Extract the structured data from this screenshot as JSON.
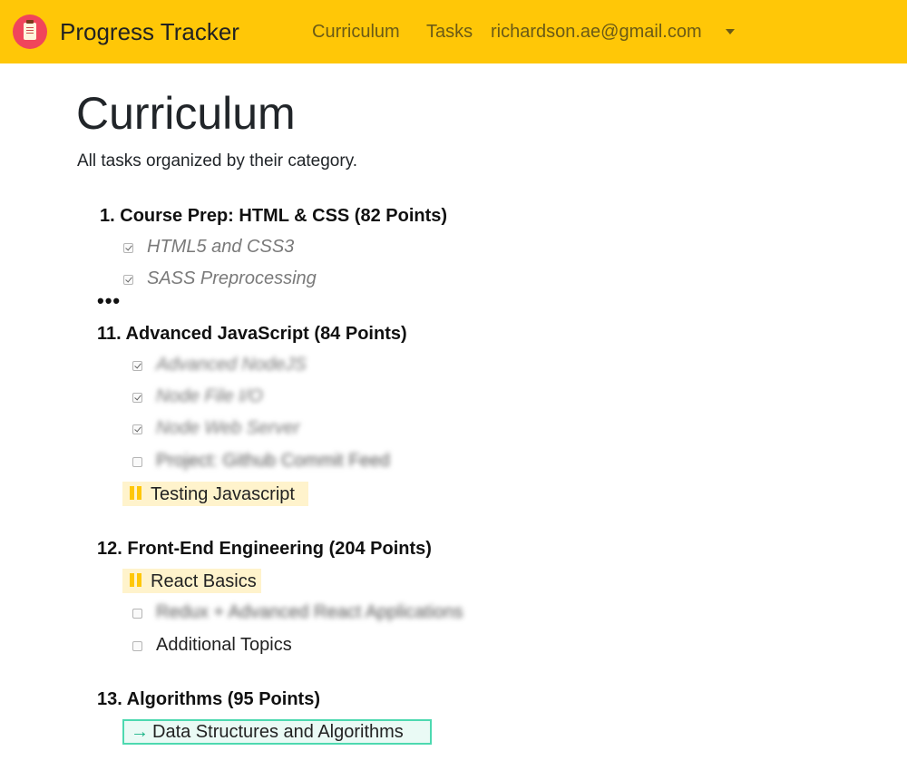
{
  "navbar": {
    "brand": "Progress Tracker",
    "links": [
      "Curriculum",
      "Tasks"
    ],
    "user_email": "richardson.ae@gmail.com",
    "colors": {
      "background": "#ffc707",
      "logo": "#f0455b"
    }
  },
  "page": {
    "title": "Curriculum",
    "subtitle": "All tasks organized by their category."
  },
  "categories": [
    {
      "number": "1.",
      "title": "Course Prep: HTML & CSS (82 Points)",
      "items": [
        {
          "label": "HTML5 and CSS3",
          "state": "complete"
        },
        {
          "label": "SASS Preprocessing",
          "state": "complete"
        }
      ]
    },
    {
      "number": "11.",
      "title": "Advanced JavaScript (84 Points)",
      "items": [
        {
          "label": "Advanced NodeJS",
          "state": "complete"
        },
        {
          "label": "Node File I/O",
          "state": "complete"
        },
        {
          "label": "Node Web Server",
          "state": "complete"
        },
        {
          "label": "Project: Github Commit Feed",
          "state": "incomplete"
        },
        {
          "label": "Testing Javascript",
          "state": "in-progress"
        }
      ]
    },
    {
      "number": "12.",
      "title": "Front-End Engineering (204 Points)",
      "items": [
        {
          "label": "React Basics",
          "state": "in-progress"
        },
        {
          "label": "Redux + Advanced React Applications",
          "state": "incomplete"
        },
        {
          "label": "Additional Topics",
          "state": "incomplete"
        }
      ]
    },
    {
      "number": "13.",
      "title": "Algorithms (95 Points)",
      "items": [
        {
          "label": "Data Structures and Algorithms",
          "state": "next"
        }
      ]
    }
  ],
  "ellipsis": "•••",
  "icons": {
    "logo": "clipboard-icon",
    "in_progress": "pause-icon",
    "next": "arrow-right-icon",
    "dropdown": "caret-down-icon"
  }
}
